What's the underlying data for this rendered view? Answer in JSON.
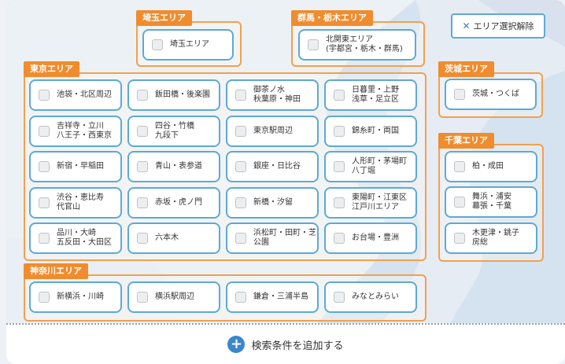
{
  "actions": {
    "clear_label": "エリア選択解除",
    "add_condition_label": "検索条件を追加する"
  },
  "groups": {
    "saitama": {
      "title": "埼玉エリア",
      "items": [
        "埼玉エリア"
      ]
    },
    "gunma": {
      "title": "群馬・栃木エリア",
      "items": [
        "北関東エリア\n(宇都宮・栃木・群馬)"
      ]
    },
    "ibaraki": {
      "title": "茨城エリア",
      "items": [
        "茨城・つくば"
      ]
    },
    "chiba": {
      "title": "千葉エリア",
      "items": [
        "柏・成田",
        "舞浜・浦安\n幕張・千葉",
        "木更津・銚子\n房総"
      ]
    },
    "tokyo": {
      "title": "東京エリア",
      "items": [
        "池袋・北区周辺",
        "飯田橋・後楽園",
        "御茶ノ水\n秋葉原・神田",
        "日暮里・上野\n浅草・足立区",
        "吉祥寺・立川\n八王子・西東京",
        "四谷・竹橋\n九段下",
        "東京駅周辺",
        "錦糸町・両国",
        "新宿・早稲田",
        "青山・表参道",
        "銀座・日比谷",
        "人形町・茅場町\n八丁堀",
        "渋谷・恵比寿\n代官山",
        "赤坂・虎ノ門",
        "新橋・汐留",
        "東陽町・江東区\n江戸川エリア",
        "品川・大崎\n五反田・大田区",
        "六本木",
        "浜松町・田町・芝\n公園",
        "お台場・豊洲"
      ]
    },
    "kanagawa": {
      "title": "神奈川エリア",
      "items": [
        "新横浜・川崎",
        "横浜駅周辺",
        "鎌倉・三浦半島",
        "みなとみらい"
      ]
    }
  }
}
